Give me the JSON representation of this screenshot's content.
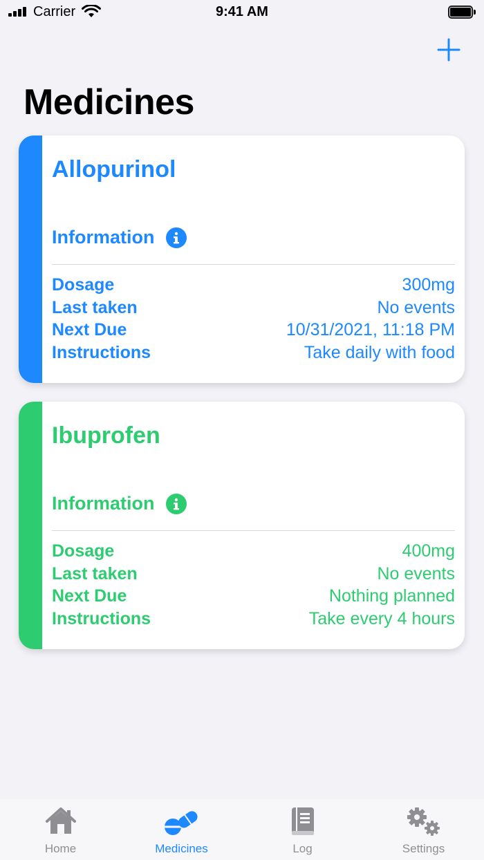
{
  "status_bar": {
    "carrier": "Carrier",
    "time": "9:41 AM"
  },
  "nav": {
    "title": "Medicines",
    "add_icon": "plus-icon"
  },
  "colors": {
    "blue": "#1e88ff",
    "green": "#2ecc71",
    "inactive": "#8e8e93"
  },
  "medicines": [
    {
      "name": "Allopurinol",
      "color": "#1e88ff",
      "info_label": "Information",
      "details": [
        {
          "label": "Dosage",
          "value": "300mg"
        },
        {
          "label": "Last taken",
          "value": "No events"
        },
        {
          "label": "Next Due",
          "value": "10/31/2021, 11:18 PM"
        },
        {
          "label": "Instructions",
          "value": "Take daily with food"
        }
      ]
    },
    {
      "name": "Ibuprofen",
      "color": "#2ecc71",
      "info_label": "Information",
      "details": [
        {
          "label": "Dosage",
          "value": "400mg"
        },
        {
          "label": "Last taken",
          "value": "No events"
        },
        {
          "label": "Next Due",
          "value": "Nothing planned"
        },
        {
          "label": "Instructions",
          "value": "Take every 4 hours"
        }
      ]
    }
  ],
  "tab_bar": {
    "tabs": [
      {
        "label": "Home",
        "icon": "house-icon",
        "active": false
      },
      {
        "label": "Medicines",
        "icon": "pills-icon",
        "active": true
      },
      {
        "label": "Log",
        "icon": "book-icon",
        "active": false
      },
      {
        "label": "Settings",
        "icon": "gears-icon",
        "active": false
      }
    ]
  }
}
